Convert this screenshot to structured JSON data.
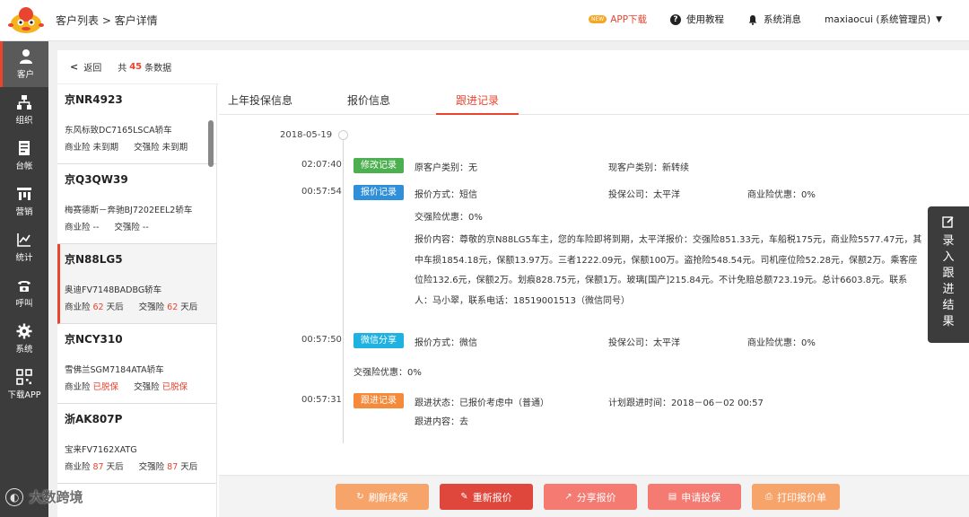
{
  "header": {
    "breadcrumb": "客户列表 > 客户详情",
    "new_badge": "NEW",
    "app_download": "APP下载",
    "tutorial": "使用教程",
    "messages": "系统消息",
    "user": "maxiaocui (系统管理员)"
  },
  "nav": [
    {
      "label": "客户",
      "icon": "customer-icon"
    },
    {
      "label": "组织",
      "icon": "org-icon"
    },
    {
      "label": "台帐",
      "icon": "ledger-icon"
    },
    {
      "label": "营销",
      "icon": "marketing-icon"
    },
    {
      "label": "统计",
      "icon": "chart-icon"
    },
    {
      "label": "呼叫",
      "icon": "phone-icon"
    },
    {
      "label": "系统",
      "icon": "gear-icon"
    },
    {
      "label": "下载APP",
      "icon": "qr-icon"
    }
  ],
  "list": {
    "back": "返回",
    "total_prefix": "共",
    "total_count": "45",
    "total_suffix": "条数据",
    "customers": [
      {
        "plate": "京NR4923",
        "model": "东风标致DC7165LSCA轿车",
        "biz_label": "商业险",
        "biz_value": "未到期",
        "comp_label": "交强险",
        "comp_value": "未到期"
      },
      {
        "plate": "京Q3QW39",
        "model": "梅赛德斯－奔驰BJ7202EEL2轿车",
        "biz_label": "商业险",
        "biz_value": "--",
        "comp_label": "交强险",
        "comp_value": "--"
      },
      {
        "plate": "京N88LG5",
        "model": "奥迪FV7148BADBG轿车",
        "biz_label": "商业险",
        "biz_num": "62",
        "biz_unit": "天后",
        "comp_label": "交强险",
        "comp_num": "62",
        "comp_unit": "天后"
      },
      {
        "plate": "京NCY310",
        "model": "雪佛兰SGM7184ATA轿车",
        "biz_label": "商业险",
        "biz_value": "已脱保",
        "comp_label": "交强险",
        "comp_value": "已脱保"
      },
      {
        "plate": "浙AK807P",
        "model": "宝来FV7162XATG",
        "biz_label": "商业险",
        "biz_num": "87",
        "biz_unit": "天后",
        "comp_label": "交强险",
        "comp_num": "87",
        "comp_unit": "天后"
      }
    ]
  },
  "tabs": [
    "上年投保信息",
    "报价信息",
    "跟进记录"
  ],
  "timeline": {
    "date": "2018-05-19",
    "entries": {
      "e1": {
        "time": "02:07:40",
        "tag": "修改记录",
        "f1": "原客户类别：无",
        "f2": "现客户类别：新转续"
      },
      "e2": {
        "time": "00:57:54",
        "tag": "报价记录",
        "f1": "报价方式：短信",
        "f2": "投保公司：太平洋",
        "f3": "商业险优惠：0%",
        "f4": "交强险优惠：0%",
        "content": "报价内容：尊敬的京N88LG5车主，您的车险即将到期，太平洋报价：交强险851.33元，车船税175元，商业险5577.47元，其中车损1854.18元，保额13.97万。三者1222.09元，保额100万。盗抢险548.54元。司机座位险52.28元，保额2万。乘客座位险132.6元，保额2万。划痕828.75元，保额1万。玻璃[国产]215.84元。不计免赔总额723.19元。总计6603.8元。联系人：马小翠，联系电话：18519001513（微信同号）"
      },
      "e3": {
        "time": "00:57:50",
        "tag": "微信分享",
        "f1": "报价方式：微信",
        "f2": "投保公司：太平洋",
        "f3": "商业险优惠：0%",
        "f4": "交强险优惠：0%"
      },
      "e4": {
        "time": "00:57:31",
        "tag": "跟进记录",
        "f1": "跟进状态：已报价考虑中（普通）",
        "f2": "计划跟进时间：2018－06－02 00:57",
        "f3": "跟进内容：去"
      }
    }
  },
  "actions": [
    "刷新续保",
    "重新报价",
    "分享报价",
    "申请投保",
    "打印报价单"
  ],
  "float_button": "录入跟进结果",
  "watermark": "大数跨境",
  "colors": {
    "accent": "#e8442f",
    "nav_bg": "#3c3c3c",
    "tag_green": "#4caf50",
    "tag_blue": "#2f8fd8",
    "tag_cyan": "#1fb1e0",
    "tag_orange": "#f58a3b"
  }
}
